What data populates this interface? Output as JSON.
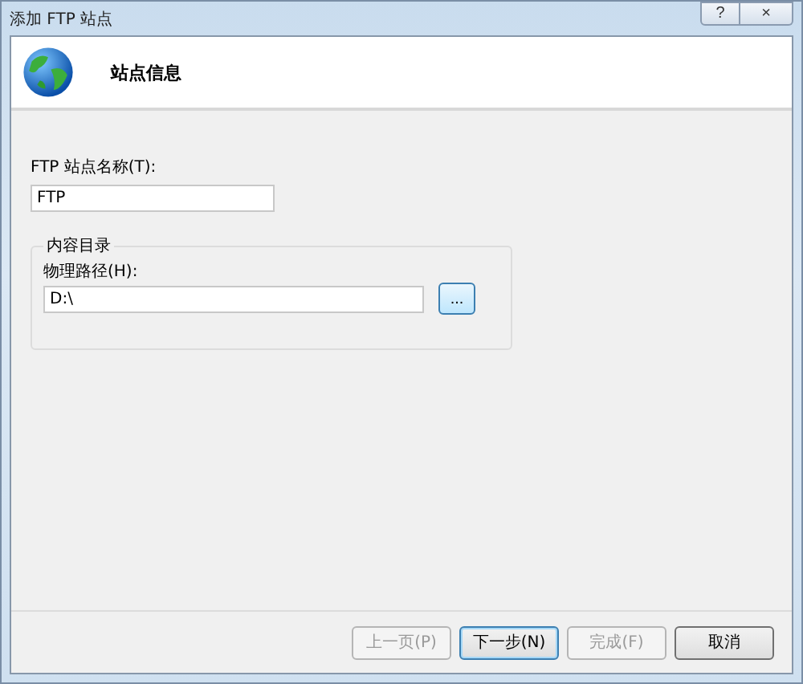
{
  "window": {
    "title": "添加 FTP 站点",
    "controls": [
      "?",
      "×"
    ]
  },
  "header": {
    "title": "站点信息"
  },
  "site_name": {
    "label": "FTP 站点名称(T):",
    "value": "FTP"
  },
  "content_directory": {
    "legend": "内容目录",
    "path_label": "物理路径(H):",
    "path_value": "D:\\",
    "browse_button": "..."
  },
  "buttons": [
    {
      "label": "上一页(P)",
      "disabled": true,
      "default": false
    },
    {
      "label": "下一步(N)",
      "disabled": false,
      "default": true
    },
    {
      "label": "完成(F)",
      "disabled": true,
      "default": false
    },
    {
      "label": "取消",
      "disabled": false,
      "default": false
    }
  ]
}
